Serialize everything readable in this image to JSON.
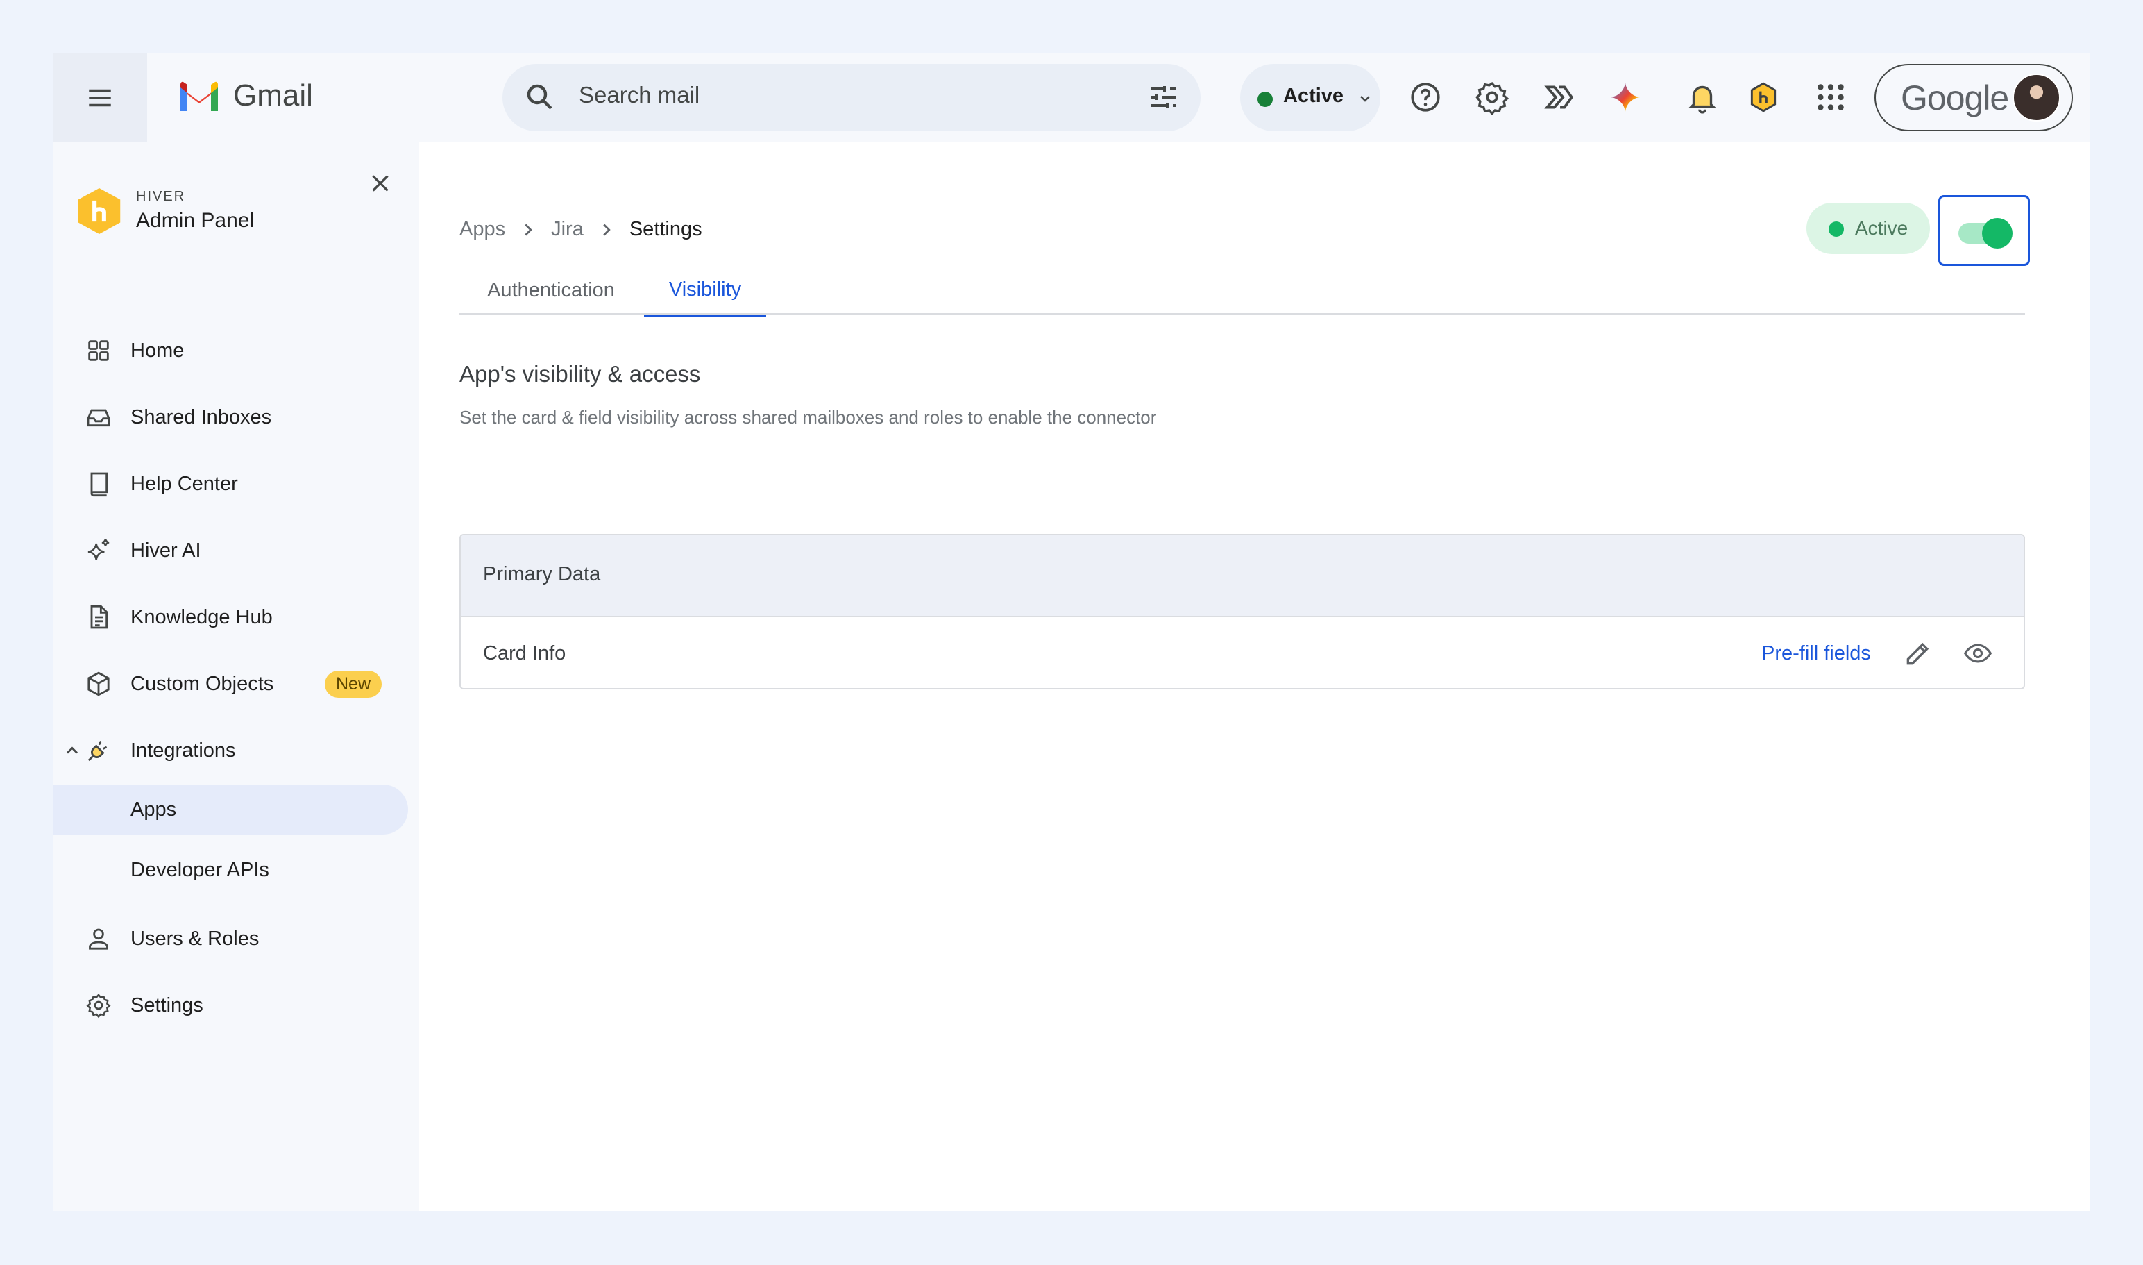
{
  "topbar": {
    "app_name": "Gmail",
    "search_placeholder": "Search mail",
    "status_label": "Active",
    "account_brand": "Google"
  },
  "sidebar": {
    "brand_small": "HIVER",
    "brand_title": "Admin Panel",
    "items": [
      {
        "label": "Home",
        "icon": "grid-icon"
      },
      {
        "label": "Shared Inboxes",
        "icon": "inbox-icon"
      },
      {
        "label": "Help Center",
        "icon": "book-icon"
      },
      {
        "label": "Hiver AI",
        "icon": "sparkle-icon"
      },
      {
        "label": "Knowledge Hub",
        "icon": "document-icon"
      },
      {
        "label": "Custom Objects",
        "icon": "cube-icon",
        "badge": "New"
      },
      {
        "label": "Integrations",
        "icon": "plug-icon"
      },
      {
        "label": "Apps",
        "sub": true,
        "active": true
      },
      {
        "label": "Developer APIs",
        "sub": true
      },
      {
        "label": "Users & Roles",
        "icon": "user-icon"
      },
      {
        "label": "Settings",
        "icon": "gear-icon"
      }
    ]
  },
  "main": {
    "breadcrumb": [
      "Apps",
      "Jira",
      "Settings"
    ],
    "active_chip": "Active",
    "toggle_on": true,
    "tabs": [
      "Authentication",
      "Visibility"
    ],
    "selected_tab": "Visibility",
    "section_title": "App's visibility & access",
    "section_desc": "Set the card & field visibility across shared mailboxes and roles to enable the connector",
    "card": {
      "header": "Primary Data",
      "row_label": "Card Info",
      "row_link": "Pre-fill fields"
    }
  },
  "colors": {
    "accent": "#1a56db",
    "active_green": "#14b866",
    "badge_yellow": "#fbcf4e",
    "page_bg": "#eef3fc"
  }
}
